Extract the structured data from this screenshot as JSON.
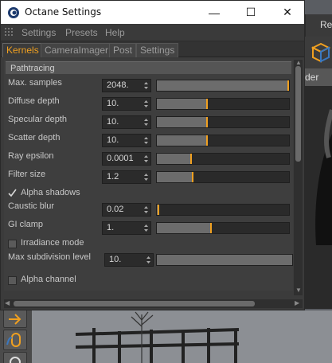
{
  "window": {
    "title": "Octane Settings",
    "minimize_glyph": "—",
    "maximize_glyph": "☐",
    "close_glyph": "✕"
  },
  "menu": [
    "Settings",
    "Presets",
    "Help"
  ],
  "tabs": [
    {
      "label": "Kernels",
      "active": true
    },
    {
      "label": "CameraImager",
      "active": false
    },
    {
      "label": "Post",
      "active": false
    },
    {
      "label": "Settings",
      "active": false
    }
  ],
  "section": {
    "title": "Pathtracing"
  },
  "params": {
    "max_samples": {
      "label": "Max. samples",
      "value": "2048.",
      "slider_fraction": 1.0
    },
    "diffuse_depth": {
      "label": "Diffuse depth",
      "value": "10.",
      "slider_fraction": 0.38
    },
    "specular_depth": {
      "label": "Specular depth",
      "value": "10.",
      "slider_fraction": 0.38
    },
    "scatter_depth": {
      "label": "Scatter depth",
      "value": "10.",
      "slider_fraction": 0.38
    },
    "ray_epsilon": {
      "label": "Ray epsilon",
      "value": "0.0001",
      "slider_fraction": 0.26
    },
    "filter_size": {
      "label": "Filter size",
      "value": "1.2",
      "slider_fraction": 0.27
    },
    "alpha_shadows": {
      "label": "Alpha shadows",
      "checked": true
    },
    "caustic_blur": {
      "label": "Caustic blur",
      "value": "0.02",
      "slider_fraction": 0.01
    },
    "gi_clamp": {
      "label": "GI clamp",
      "value": "1.",
      "slider_fraction": 0.41
    },
    "irradiance_mode": {
      "label": "Irradiance mode",
      "checked": false
    },
    "max_subdivision_level": {
      "label": "Max subdivision level",
      "value": "10.",
      "slider_fraction": 1.0
    },
    "alpha_channel": {
      "label": "Alpha channel",
      "checked": false
    }
  },
  "background": {
    "top_right_text": "Re",
    "panel_text": "der"
  },
  "colors": {
    "accent": "#f0a020",
    "panel": "#3b3b3b",
    "field": "#2b2b2b"
  }
}
